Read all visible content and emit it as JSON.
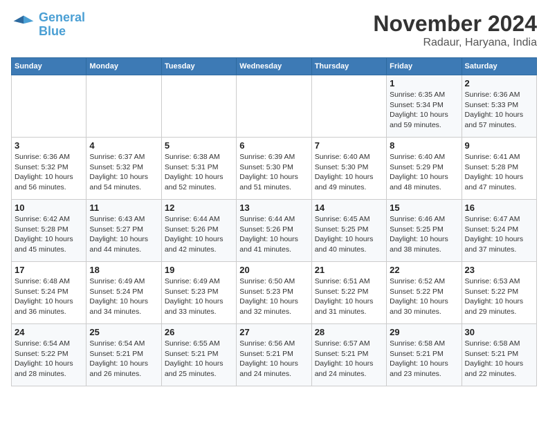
{
  "header": {
    "logo_line1": "General",
    "logo_line2": "Blue",
    "month": "November 2024",
    "location": "Radaur, Haryana, India"
  },
  "weekdays": [
    "Sunday",
    "Monday",
    "Tuesday",
    "Wednesday",
    "Thursday",
    "Friday",
    "Saturday"
  ],
  "weeks": [
    [
      {
        "day": "",
        "info": ""
      },
      {
        "day": "",
        "info": ""
      },
      {
        "day": "",
        "info": ""
      },
      {
        "day": "",
        "info": ""
      },
      {
        "day": "",
        "info": ""
      },
      {
        "day": "1",
        "info": "Sunrise: 6:35 AM\nSunset: 5:34 PM\nDaylight: 10 hours and 59 minutes."
      },
      {
        "day": "2",
        "info": "Sunrise: 6:36 AM\nSunset: 5:33 PM\nDaylight: 10 hours and 57 minutes."
      }
    ],
    [
      {
        "day": "3",
        "info": "Sunrise: 6:36 AM\nSunset: 5:32 PM\nDaylight: 10 hours and 56 minutes."
      },
      {
        "day": "4",
        "info": "Sunrise: 6:37 AM\nSunset: 5:32 PM\nDaylight: 10 hours and 54 minutes."
      },
      {
        "day": "5",
        "info": "Sunrise: 6:38 AM\nSunset: 5:31 PM\nDaylight: 10 hours and 52 minutes."
      },
      {
        "day": "6",
        "info": "Sunrise: 6:39 AM\nSunset: 5:30 PM\nDaylight: 10 hours and 51 minutes."
      },
      {
        "day": "7",
        "info": "Sunrise: 6:40 AM\nSunset: 5:30 PM\nDaylight: 10 hours and 49 minutes."
      },
      {
        "day": "8",
        "info": "Sunrise: 6:40 AM\nSunset: 5:29 PM\nDaylight: 10 hours and 48 minutes."
      },
      {
        "day": "9",
        "info": "Sunrise: 6:41 AM\nSunset: 5:28 PM\nDaylight: 10 hours and 47 minutes."
      }
    ],
    [
      {
        "day": "10",
        "info": "Sunrise: 6:42 AM\nSunset: 5:28 PM\nDaylight: 10 hours and 45 minutes."
      },
      {
        "day": "11",
        "info": "Sunrise: 6:43 AM\nSunset: 5:27 PM\nDaylight: 10 hours and 44 minutes."
      },
      {
        "day": "12",
        "info": "Sunrise: 6:44 AM\nSunset: 5:26 PM\nDaylight: 10 hours and 42 minutes."
      },
      {
        "day": "13",
        "info": "Sunrise: 6:44 AM\nSunset: 5:26 PM\nDaylight: 10 hours and 41 minutes."
      },
      {
        "day": "14",
        "info": "Sunrise: 6:45 AM\nSunset: 5:25 PM\nDaylight: 10 hours and 40 minutes."
      },
      {
        "day": "15",
        "info": "Sunrise: 6:46 AM\nSunset: 5:25 PM\nDaylight: 10 hours and 38 minutes."
      },
      {
        "day": "16",
        "info": "Sunrise: 6:47 AM\nSunset: 5:24 PM\nDaylight: 10 hours and 37 minutes."
      }
    ],
    [
      {
        "day": "17",
        "info": "Sunrise: 6:48 AM\nSunset: 5:24 PM\nDaylight: 10 hours and 36 minutes."
      },
      {
        "day": "18",
        "info": "Sunrise: 6:49 AM\nSunset: 5:24 PM\nDaylight: 10 hours and 34 minutes."
      },
      {
        "day": "19",
        "info": "Sunrise: 6:49 AM\nSunset: 5:23 PM\nDaylight: 10 hours and 33 minutes."
      },
      {
        "day": "20",
        "info": "Sunrise: 6:50 AM\nSunset: 5:23 PM\nDaylight: 10 hours and 32 minutes."
      },
      {
        "day": "21",
        "info": "Sunrise: 6:51 AM\nSunset: 5:22 PM\nDaylight: 10 hours and 31 minutes."
      },
      {
        "day": "22",
        "info": "Sunrise: 6:52 AM\nSunset: 5:22 PM\nDaylight: 10 hours and 30 minutes."
      },
      {
        "day": "23",
        "info": "Sunrise: 6:53 AM\nSunset: 5:22 PM\nDaylight: 10 hours and 29 minutes."
      }
    ],
    [
      {
        "day": "24",
        "info": "Sunrise: 6:54 AM\nSunset: 5:22 PM\nDaylight: 10 hours and 28 minutes."
      },
      {
        "day": "25",
        "info": "Sunrise: 6:54 AM\nSunset: 5:21 PM\nDaylight: 10 hours and 26 minutes."
      },
      {
        "day": "26",
        "info": "Sunrise: 6:55 AM\nSunset: 5:21 PM\nDaylight: 10 hours and 25 minutes."
      },
      {
        "day": "27",
        "info": "Sunrise: 6:56 AM\nSunset: 5:21 PM\nDaylight: 10 hours and 24 minutes."
      },
      {
        "day": "28",
        "info": "Sunrise: 6:57 AM\nSunset: 5:21 PM\nDaylight: 10 hours and 24 minutes."
      },
      {
        "day": "29",
        "info": "Sunrise: 6:58 AM\nSunset: 5:21 PM\nDaylight: 10 hours and 23 minutes."
      },
      {
        "day": "30",
        "info": "Sunrise: 6:58 AM\nSunset: 5:21 PM\nDaylight: 10 hours and 22 minutes."
      }
    ]
  ]
}
